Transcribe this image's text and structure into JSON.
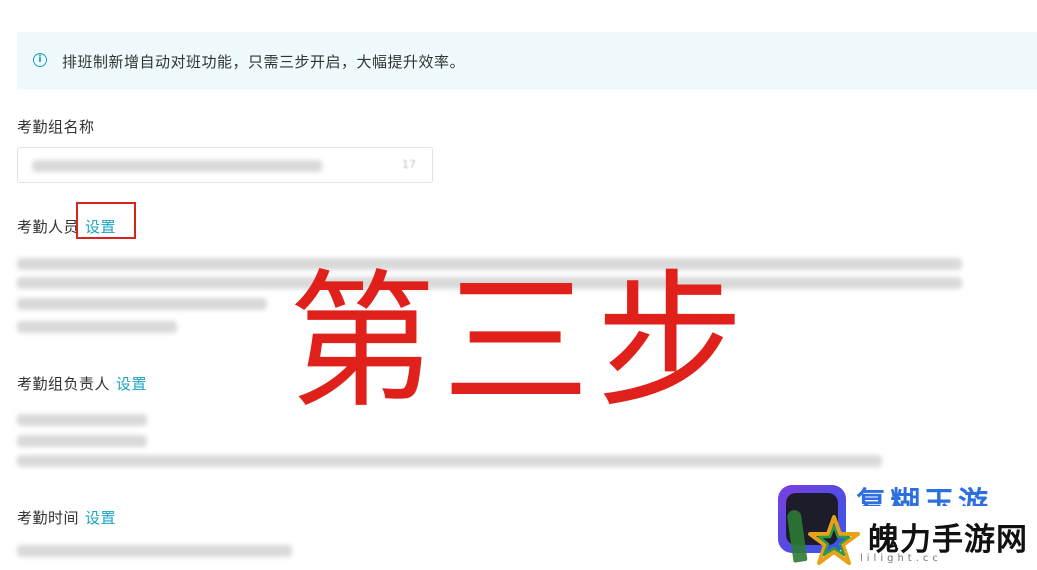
{
  "notice": {
    "icon": "info-icon",
    "text": "排班制新增自动对班功能，只需三步开启，大幅提升效率。"
  },
  "fields": {
    "group_name": {
      "label": "考勤组名称",
      "counter": "17"
    },
    "members": {
      "label": "考勤人员",
      "link": "设置"
    },
    "managers": {
      "label": "考勤组负责人",
      "link": "设置"
    },
    "time": {
      "label": "考勤时间",
      "link": "设置"
    }
  },
  "overlay": {
    "step_text": "第三步"
  },
  "watermark": {
    "top_text": "复糊玉游",
    "main_text": "魄力手游网",
    "url_text": "lilight.cc"
  },
  "colors": {
    "accent": "#1aa4c2",
    "notice_bg": "#eefafc",
    "highlight": "#d9231d",
    "overlay_text": "#e0201a"
  }
}
